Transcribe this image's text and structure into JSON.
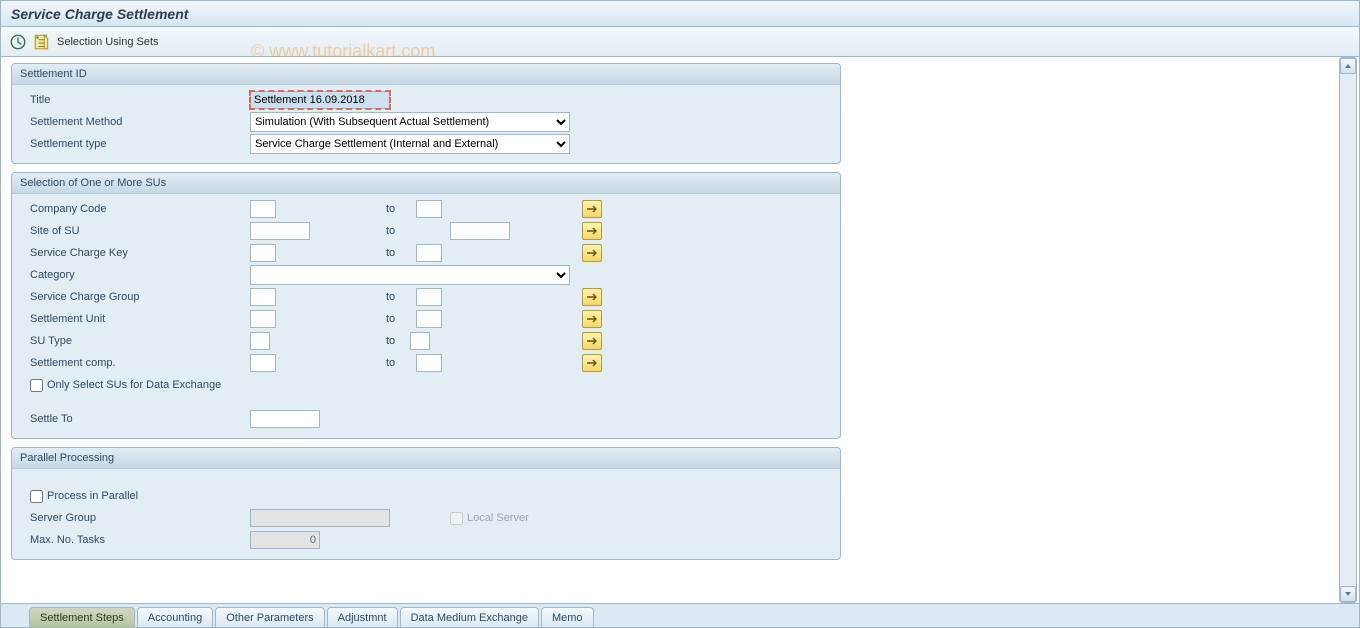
{
  "title": "Service Charge Settlement",
  "toolbar": {
    "exec_tooltip": "Execute",
    "sets_label": "Selection Using Sets"
  },
  "watermark": "© www.tutorialkart.com",
  "panels": {
    "settlement_id": {
      "header": "Settlement ID",
      "title_label": "Title",
      "title_value": "Settlement 16.09.2018",
      "method_label": "Settlement Method",
      "method_value": "Simulation (With Subsequent Actual Settlement)",
      "type_label": "Settlement type",
      "type_value": "Service Charge Settlement (Internal and External)"
    },
    "su_selection": {
      "header": "Selection of One or More SUs",
      "to": "to",
      "rows": {
        "company_code": "Company Code",
        "site_of_su": "Site of SU",
        "sc_key": "Service Charge Key",
        "category": "Category",
        "sc_group": "Service Charge Group",
        "settlement_unit": "Settlement Unit",
        "su_type": "SU Type",
        "settlement_comp": "Settlement comp."
      },
      "only_select": "Only Select SUs for Data Exchange",
      "settle_to": "Settle To"
    },
    "parallel": {
      "header": "Parallel Processing",
      "process": "Process in Parallel",
      "server_group": "Server Group",
      "local_server": "Local Server",
      "max_tasks": "Max. No. Tasks",
      "max_tasks_value": "0"
    }
  },
  "tabs": [
    "Settlement Steps",
    "Accounting",
    "Other Parameters",
    "Adjustmnt",
    "Data Medium Exchange",
    "Memo"
  ]
}
